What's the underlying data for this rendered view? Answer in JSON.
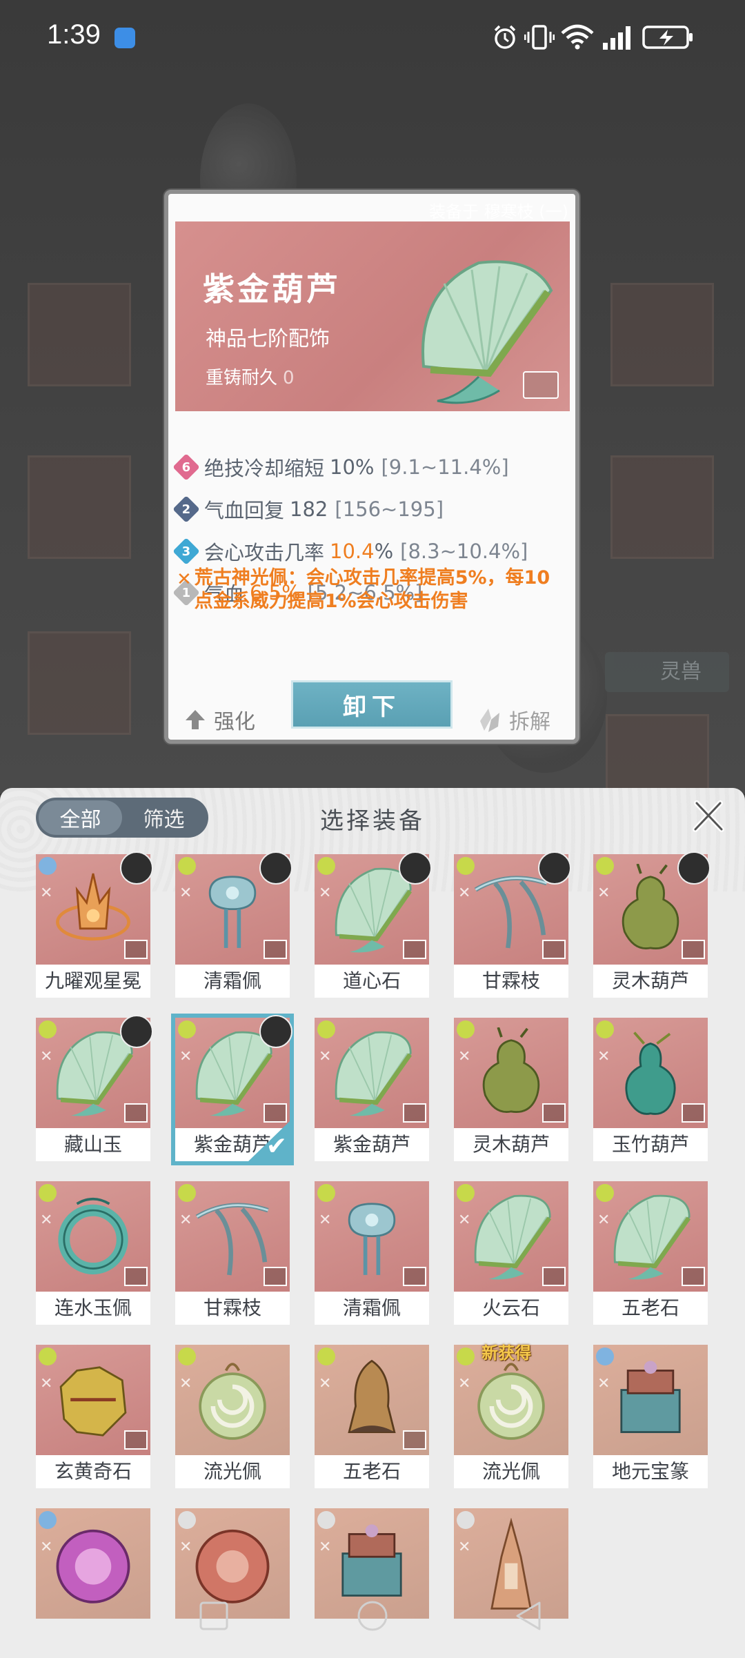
{
  "status_bar": {
    "time": "1:39",
    "icons": [
      "weather-icon",
      "alarm-icon",
      "vibrate-icon",
      "wifi-icon",
      "signal-icon",
      "battery-charging-icon"
    ]
  },
  "scene": {
    "ghost_tag": "灵兽"
  },
  "detail": {
    "equipped_on": "装备于 穆寒枝 (一)",
    "name": "紫金葫芦",
    "grade": "神品七阶配饰",
    "recast_label": "重铸耐久",
    "recast_value": "0",
    "stats": [
      {
        "badge": "6",
        "label": "绝技冷却缩短",
        "value": "10%",
        "range": "[9.1~11.4%]",
        "badge_color": "#e06a8f",
        "highlight": false
      },
      {
        "badge": "2",
        "label": "气血回复",
        "value": "182",
        "range": "[156~195]",
        "badge_color": "#55698a",
        "highlight": false
      },
      {
        "badge": "3",
        "label": "会心攻击几率",
        "value": "10.4",
        "value_suffix": "%",
        "range": "[8.3~10.4%]",
        "badge_color": "#3fa8d4",
        "highlight": true
      },
      {
        "badge": "1",
        "label": "气血",
        "value": "6.5%",
        "range": "[5.2~6.5%]",
        "badge_color": "#b8b8b8",
        "highlight": true
      }
    ],
    "special_effect": "荒古神光佩：会心攻击几率提高5%，每10点金系威力提高1%会心攻击伤害",
    "btn_strengthen": "强化",
    "btn_unequip": "卸下",
    "btn_dismantle": "拆解"
  },
  "panel": {
    "tab_all": "全部",
    "tab_filter": "筛选",
    "title": "选择装备",
    "items": [
      {
        "name": "九曜观星冕",
        "theme": "red",
        "elem": "#7fb3e0",
        "avatar": true,
        "art": "crown"
      },
      {
        "name": "清霜佩",
        "theme": "red",
        "elem": "#c7d94a",
        "avatar": true,
        "art": "pendant"
      },
      {
        "name": "道心石",
        "theme": "red",
        "elem": "#c7d94a",
        "avatar": true,
        "art": "fan"
      },
      {
        "name": "甘霖枝",
        "theme": "red",
        "elem": "#c7d94a",
        "avatar": true,
        "art": "branch"
      },
      {
        "name": "灵木葫芦",
        "theme": "red",
        "elem": "#c7d94a",
        "avatar": true,
        "art": "gourd"
      },
      {
        "name": "藏山玉",
        "theme": "red",
        "elem": "#c7d94a",
        "avatar": true,
        "art": "fan"
      },
      {
        "name": "紫金葫芦",
        "theme": "red",
        "elem": "#c7d94a",
        "avatar": true,
        "art": "fan",
        "selected": true
      },
      {
        "name": "紫金葫芦",
        "theme": "red",
        "elem": "#c7d94a",
        "avatar": false,
        "art": "fan"
      },
      {
        "name": "灵木葫芦",
        "theme": "red",
        "elem": "#c7d94a",
        "avatar": false,
        "art": "gourd"
      },
      {
        "name": "玉竹葫芦",
        "theme": "red",
        "elem": "#c7d94a",
        "avatar": false,
        "art": "gourd2"
      },
      {
        "name": "连水玉佩",
        "theme": "red",
        "elem": "#c7d94a",
        "avatar": false,
        "art": "ring"
      },
      {
        "name": "甘霖枝",
        "theme": "red",
        "elem": "#c7d94a",
        "avatar": false,
        "art": "branch"
      },
      {
        "name": "清霜佩",
        "theme": "red",
        "elem": "#c7d94a",
        "avatar": false,
        "art": "pendant"
      },
      {
        "name": "火云石",
        "theme": "red",
        "elem": "#c7d94a",
        "avatar": false,
        "art": "fan"
      },
      {
        "name": "五老石",
        "theme": "red",
        "elem": "#c7d94a",
        "avatar": false,
        "art": "fan"
      },
      {
        "name": "玄黄奇石",
        "theme": "red",
        "elem": "#c7d94a",
        "avatar": false,
        "art": "rock"
      },
      {
        "name": "流光佩",
        "theme": "tan",
        "elem": "#c7d94a",
        "avatar": false,
        "art": "disc"
      },
      {
        "name": "五老石",
        "theme": "tan",
        "elem": "#c7d94a",
        "avatar": false,
        "art": "stone"
      },
      {
        "name": "流光佩",
        "theme": "tan",
        "elem": "#c7d94a",
        "avatar": false,
        "art": "disc",
        "new_tag": "新获得"
      },
      {
        "name": "地元宝篆",
        "theme": "tan",
        "elem": "#7fb3e0",
        "avatar": false,
        "art": "box"
      },
      {
        "name": "",
        "theme": "tan",
        "elem": "#7fb3e0",
        "avatar": false,
        "art": "orb"
      },
      {
        "name": "",
        "theme": "tan",
        "elem": "#e0e0e0",
        "avatar": false,
        "art": "medal"
      },
      {
        "name": "",
        "theme": "tan",
        "elem": "#e0e0e0",
        "avatar": false,
        "art": "box"
      },
      {
        "name": "",
        "theme": "tan",
        "elem": "#e0e0e0",
        "avatar": false,
        "art": "spire"
      }
    ]
  },
  "navbar": {
    "buttons": [
      "recent-apps-button",
      "home-button",
      "back-button"
    ]
  }
}
